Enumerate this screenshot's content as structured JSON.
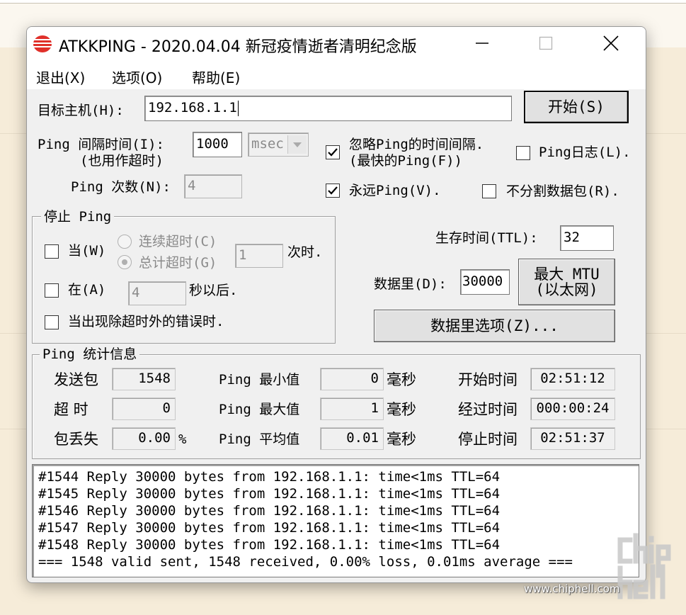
{
  "window": {
    "title": "ATKKPING - 2020.04.04 新冠疫情逝者清明纪念版",
    "minimize_icon": "minimize-icon",
    "maximize_icon": "maximize-icon",
    "close_icon": "close-icon"
  },
  "menu": [
    "退出(X)",
    "选项(O)",
    "帮助(E)"
  ],
  "target": {
    "label": "目标主机(H):",
    "value": "192.168.1.1",
    "start_button": "开始(S)"
  },
  "interval": {
    "label_line1": "Ping 间隔时间(I):",
    "label_line2": "(也用作超时)",
    "value": "1000",
    "unit": "msec"
  },
  "count": {
    "label": "Ping 次数(N):",
    "value": "4"
  },
  "options": {
    "ignore_interval_line1": "忽略Ping的时间间隔.",
    "ignore_interval_line2": "(最快的Ping(F))",
    "ignore_interval_checked": true,
    "ping_log": "Ping日志(L).",
    "ping_log_checked": false,
    "forever": "永远Ping(V).",
    "forever_checked": true,
    "no_fragment": "不分割数据包(R).",
    "no_fragment_checked": false
  },
  "stop_group": {
    "title": "停止 Ping",
    "when_label": "当(W)",
    "consecutive_timeout": "连续超时(C)",
    "total_timeout": "总计超时(G)",
    "times_value": "1",
    "times_suffix": "次时.",
    "at_label": "在(A)",
    "seconds_value": "4",
    "seconds_suffix": "秒以后.",
    "error_label": "当出现除超时外的错误时."
  },
  "ttl": {
    "label": "生存时间(TTL):",
    "value": "32"
  },
  "data_size": {
    "label": "数据里(D):",
    "value": "30000",
    "max_mtu_line1": "最大 MTU",
    "max_mtu_line2": "(以太网)",
    "options_button": "数据里选项(Z)..."
  },
  "stats": {
    "title": "Ping 统计信息",
    "sent_label": "发送包",
    "sent_value": "1548",
    "timeout_label": "超  时",
    "timeout_value": "0",
    "loss_label": "包丢失",
    "loss_value": "0.00",
    "loss_unit": "%",
    "min_label": "Ping 最小值",
    "min_value": "0",
    "max_label": "Ping 最大值",
    "max_value": "1",
    "avg_label": "Ping 平均值",
    "avg_value": "0.01",
    "ms_unit": "毫秒",
    "start_label": "开始时间",
    "start_value": "02:51:12",
    "elapsed_label": "经过时间",
    "elapsed_value": "000:00:24",
    "stop_label": "停止时间",
    "stop_value": "02:51:37"
  },
  "log_lines": [
    "#1544 Reply 30000 bytes from 192.168.1.1: time<1ms TTL=64",
    "#1545 Reply 30000 bytes from 192.168.1.1: time<1ms TTL=64",
    "#1546 Reply 30000 bytes from 192.168.1.1: time<1ms TTL=64",
    "#1547 Reply 30000 bytes from 192.168.1.1: time<1ms TTL=64",
    "#1548 Reply 30000 bytes from 192.168.1.1: time<1ms TTL=64",
    "=== 1548 valid sent, 1548 received, 0.00% loss, 0.01ms average ==="
  ],
  "watermark": {
    "logo_text": "chip hell",
    "site": "www.chiphell.com"
  },
  "colors": {
    "accent_red": "#e0302a",
    "background": "#f6ecd9",
    "window": "#f0f0f0"
  }
}
